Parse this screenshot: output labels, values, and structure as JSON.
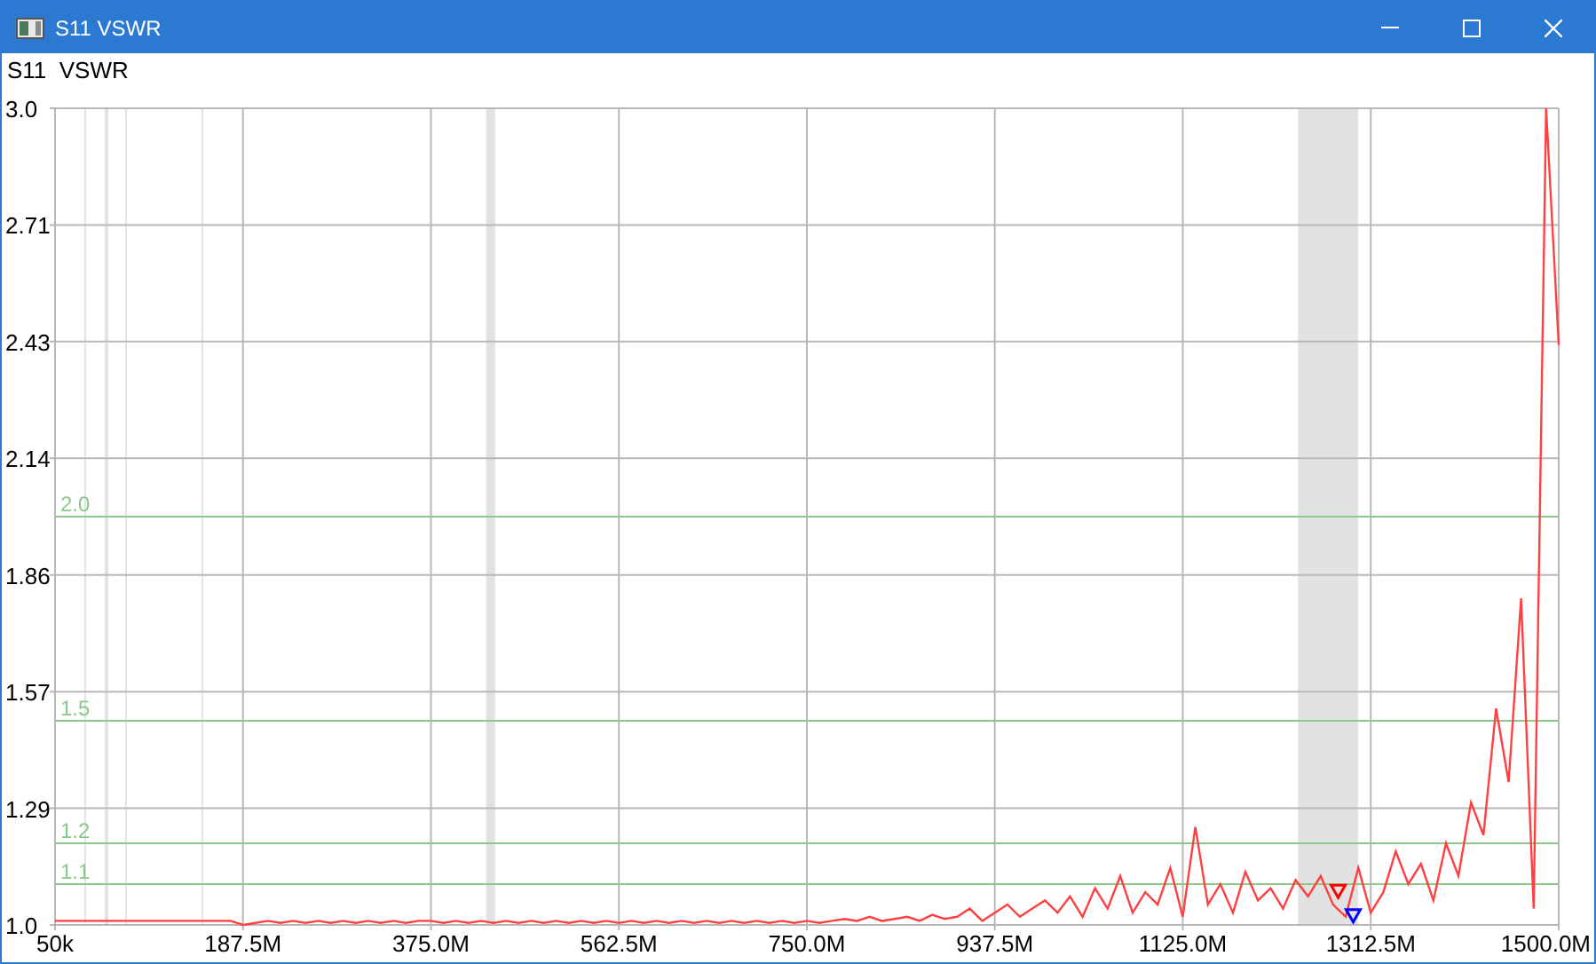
{
  "window": {
    "title": "S11 VSWR"
  },
  "chart": {
    "chart_data": {
      "type": "line",
      "title": "S11  VSWR",
      "x": [
        50000,
        12500000,
        25000000,
        37500000,
        50000000,
        62500000,
        75000000,
        87500000,
        100000000,
        112500000,
        125000000,
        137500000,
        150000000,
        162500000,
        175000000,
        187500000,
        200000000,
        212500000,
        225000000,
        237500000,
        250000000,
        262500000,
        275000000,
        287500000,
        300000000,
        312500000,
        325000000,
        337500000,
        350000000,
        362500000,
        375000000,
        387500000,
        400000000,
        412500000,
        425000000,
        437500000,
        450000000,
        462500000,
        475000000,
        487500000,
        500000000,
        512500000,
        525000000,
        537500000,
        550000000,
        562500000,
        575000000,
        587500000,
        600000000,
        612500000,
        625000000,
        637500000,
        650000000,
        662500000,
        675000000,
        687500000,
        700000000,
        712500000,
        725000000,
        737500000,
        750000000,
        762500000,
        775000000,
        787500000,
        800000000,
        812500000,
        825000000,
        837500000,
        850000000,
        862500000,
        875000000,
        887500000,
        900000000,
        912500000,
        925000000,
        937500000,
        950000000,
        962500000,
        975000000,
        987500000,
        1000000000,
        1012500000,
        1025000000,
        1037500000,
        1050000000,
        1062500000,
        1075000000,
        1087500000,
        1100000000,
        1112500000,
        1125000000,
        1137500000,
        1150000000,
        1162500000,
        1175000000,
        1187500000,
        1200000000,
        1212500000,
        1225000000,
        1237500000,
        1250000000,
        1262500000,
        1275000000,
        1287500000,
        1300000000,
        1312500000,
        1325000000,
        1337500000,
        1350000000,
        1362500000,
        1375000000,
        1387500000,
        1400000000,
        1412500000,
        1425000000,
        1437500000,
        1450000000,
        1462500000,
        1475000000,
        1487500000,
        1500000000
      ],
      "series": [
        {
          "color": "#ff4040",
          "values": [
            1.01,
            1.01,
            1.01,
            1.01,
            1.01,
            1.01,
            1.01,
            1.01,
            1.01,
            1.01,
            1.01,
            1.01,
            1.01,
            1.01,
            1.01,
            1.0,
            1.005,
            1.01,
            1.005,
            1.01,
            1.005,
            1.01,
            1.005,
            1.01,
            1.005,
            1.01,
            1.005,
            1.01,
            1.005,
            1.01,
            1.01,
            1.005,
            1.01,
            1.005,
            1.01,
            1.005,
            1.01,
            1.005,
            1.01,
            1.005,
            1.01,
            1.005,
            1.01,
            1.005,
            1.01,
            1.005,
            1.01,
            1.005,
            1.01,
            1.005,
            1.01,
            1.005,
            1.01,
            1.005,
            1.01,
            1.005,
            1.01,
            1.005,
            1.01,
            1.005,
            1.01,
            1.005,
            1.01,
            1.015,
            1.01,
            1.02,
            1.01,
            1.015,
            1.02,
            1.01,
            1.025,
            1.015,
            1.02,
            1.04,
            1.01,
            1.03,
            1.05,
            1.02,
            1.04,
            1.06,
            1.03,
            1.07,
            1.02,
            1.09,
            1.04,
            1.12,
            1.03,
            1.08,
            1.05,
            1.14,
            1.02,
            1.24,
            1.05,
            1.1,
            1.03,
            1.13,
            1.06,
            1.09,
            1.04,
            1.11,
            1.07,
            1.12,
            1.05,
            1.02,
            1.14,
            1.03,
            1.08,
            1.18,
            1.1,
            1.15,
            1.06,
            1.2,
            1.12,
            1.3,
            1.22,
            1.53,
            1.35,
            1.8,
            1.04,
            3.0,
            2.42
          ]
        }
      ],
      "xlim": [
        50000,
        1500000000
      ],
      "ylim": [
        1.0,
        3.0
      ],
      "xticks": [
        {
          "value": 50000,
          "label": "50k"
        },
        {
          "value": 187500000,
          "label": "187.5M"
        },
        {
          "value": 375000000,
          "label": "375.0M"
        },
        {
          "value": 562500000,
          "label": "562.5M"
        },
        {
          "value": 750000000,
          "label": "750.0M"
        },
        {
          "value": 937500000,
          "label": "937.5M"
        },
        {
          "value": 1125000000,
          "label": "1125.0M"
        },
        {
          "value": 1312500000,
          "label": "1312.5M"
        },
        {
          "value": 1500000000,
          "label": "1500.0M"
        }
      ],
      "yticks": [
        {
          "value": 1.0,
          "label": "1.0"
        },
        {
          "value": 1.2857,
          "label": "1.29"
        },
        {
          "value": 1.5714,
          "label": "1.57"
        },
        {
          "value": 1.8571,
          "label": "1.86"
        },
        {
          "value": 2.1429,
          "label": "2.14"
        },
        {
          "value": 2.4286,
          "label": "2.43"
        },
        {
          "value": 2.7143,
          "label": "2.71"
        },
        {
          "value": 3.0,
          "label": "3.0"
        }
      ],
      "bands": [
        {
          "axis": "x",
          "from": 430000000,
          "to": 439000000
        },
        {
          "axis": "x",
          "from": 1240000000,
          "to": 1300000000
        }
      ],
      "ref_lines": [
        {
          "axis": "y",
          "value": 2.0,
          "label": "2.0"
        },
        {
          "axis": "y",
          "value": 1.5,
          "label": "1.5"
        },
        {
          "axis": "y",
          "value": 1.2,
          "label": "1.2"
        },
        {
          "axis": "y",
          "value": 1.1,
          "label": "1.1"
        }
      ],
      "grid": true
    },
    "markers": [
      {
        "color": "#ff0000"
      },
      {
        "color": "#0000ff"
      }
    ]
  }
}
